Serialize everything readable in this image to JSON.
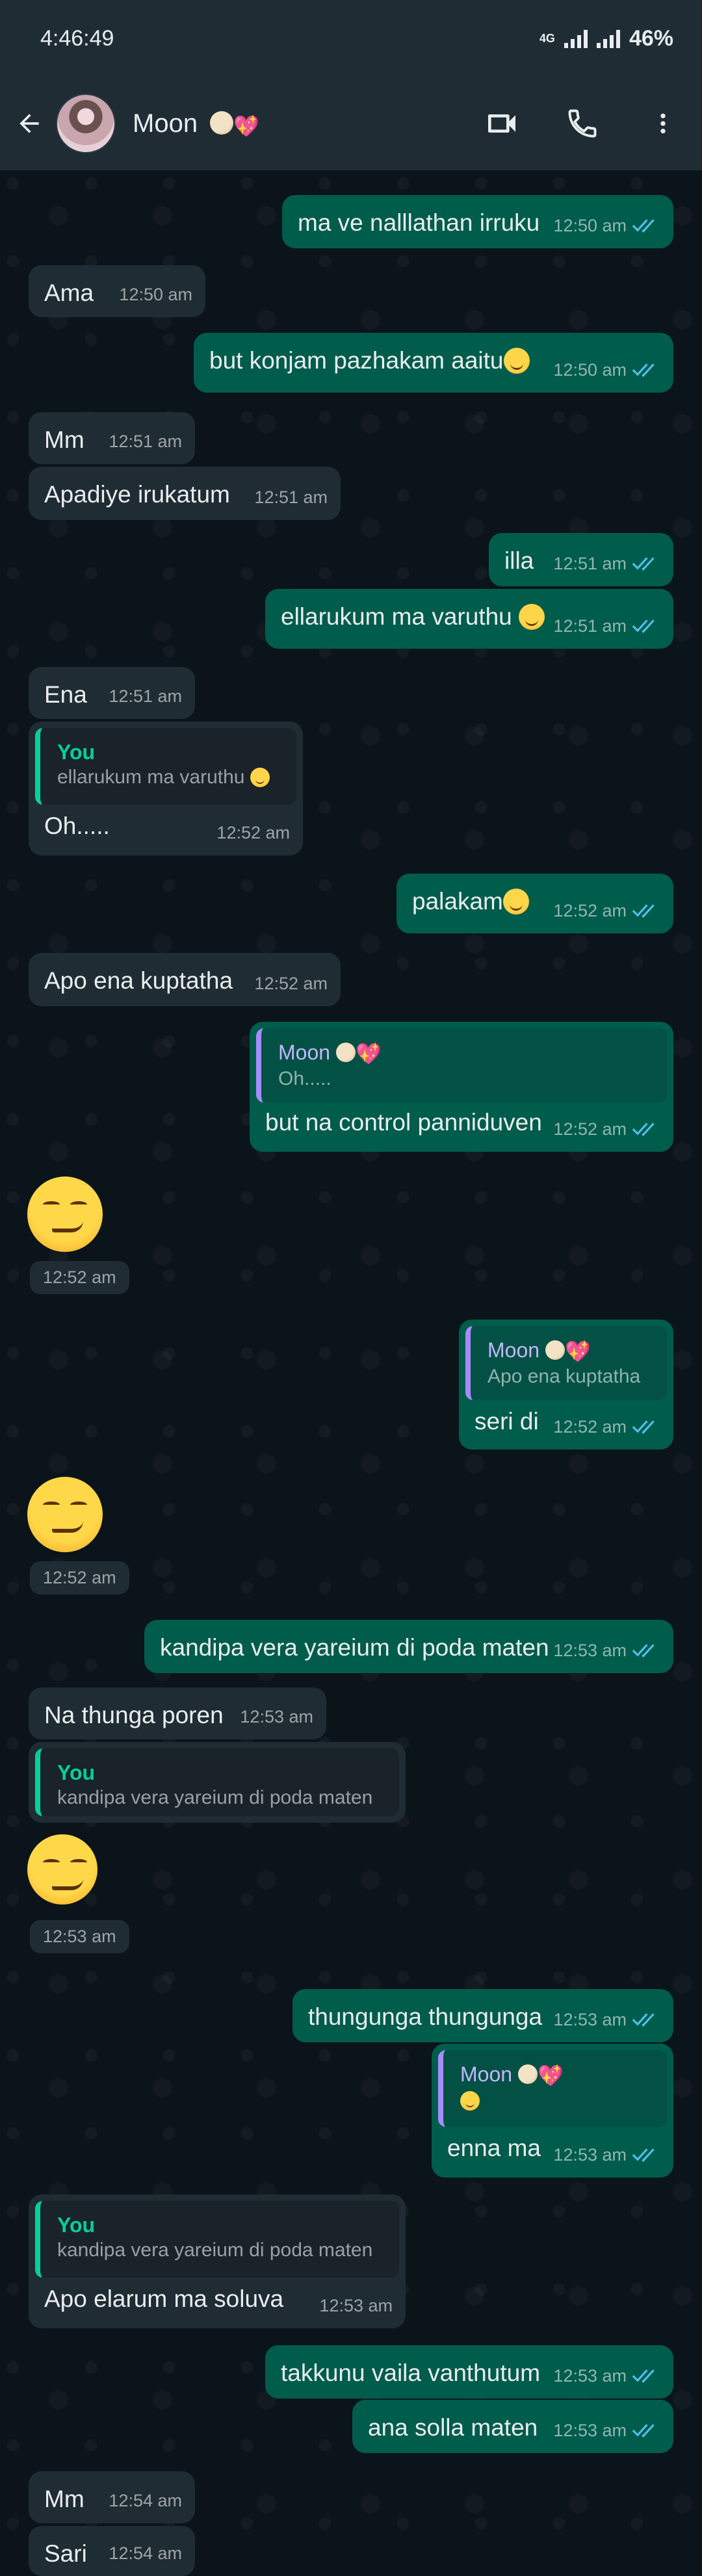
{
  "status_bar": {
    "time": "4:46:49",
    "network": "4G",
    "battery": "46%"
  },
  "header": {
    "contact_name": "Moon",
    "icons": [
      "back-arrow-icon",
      "video-call-icon",
      "voice-call-icon",
      "more-options-icon"
    ]
  },
  "colors": {
    "incoming": "#202c33",
    "outgoing": "#005c4b",
    "background": "#0b141a",
    "accent": "#06cf9c",
    "ticks": "#53bdeb"
  },
  "messages": [
    {
      "dir": "out",
      "text": "ma ve nalllathan irruku",
      "time": "12:50 am"
    },
    {
      "dir": "in",
      "text": "Ama",
      "time": "12:50 am"
    },
    {
      "dir": "out",
      "text": "but konjam pazhakam aaitu",
      "emoji": "grinning-sweat",
      "time": "12:50 am"
    },
    {
      "dir": "in",
      "text": "Mm",
      "time": "12:51 am"
    },
    {
      "dir": "in",
      "text": "Apadiye irukatum",
      "time": "12:51 am"
    },
    {
      "dir": "out",
      "text": "illa",
      "time": "12:51 am"
    },
    {
      "dir": "out",
      "text": "ellarukum ma varuthu",
      "emoji": "grinning-sweat",
      "time": "12:51 am"
    },
    {
      "dir": "in",
      "text": "Ena",
      "time": "12:51 am"
    },
    {
      "dir": "in",
      "quote_name": "You",
      "quote_text": "ellarukum ma varuthu",
      "text": "Oh.....",
      "time": "12:52 am"
    },
    {
      "dir": "out",
      "text": "palakam",
      "emoji": "grinning-sweat",
      "time": "12:52 am"
    },
    {
      "dir": "in",
      "text": "Apo ena kuptatha",
      "time": "12:52 am"
    },
    {
      "dir": "out",
      "quote_name": "Moon",
      "quote_text": "Oh.....",
      "text": "but na control panniduven",
      "time": "12:52 am"
    },
    {
      "dir": "in",
      "emoji_only": "smirking-face",
      "time": "12:52 am"
    },
    {
      "dir": "out",
      "quote_name": "Moon",
      "quote_text": "Apo ena kuptatha",
      "text": "seri di",
      "time": "12:52 am"
    },
    {
      "dir": "in",
      "emoji_only": "smirking-face",
      "time": "12:52 am"
    },
    {
      "dir": "out",
      "text": "kandipa vera yareium di poda maten",
      "time": "12:53 am"
    },
    {
      "dir": "in",
      "text": "Na thunga poren",
      "time": "12:53 am"
    },
    {
      "dir": "in",
      "quote_name": "You",
      "quote_text": "kandipa vera yareium di poda maten",
      "emoji_only": "smirking-face",
      "time": "12:53 am"
    },
    {
      "dir": "out",
      "text": "thungunga thungunga",
      "time": "12:53 am"
    },
    {
      "dir": "out",
      "quote_name": "Moon",
      "quote_emoji": "smirking-face",
      "text": "enna ma",
      "time": "12:53 am"
    },
    {
      "dir": "in",
      "quote_name": "You",
      "quote_text": "kandipa vera yareium di poda maten",
      "text": "Apo elarum ma soluva",
      "time": "12:53 am"
    },
    {
      "dir": "out",
      "text": "takkunu vaila vanthutum",
      "time": "12:53 am"
    },
    {
      "dir": "out",
      "text": "ana solla maten",
      "time": "12:53 am"
    },
    {
      "dir": "in",
      "text": "Mm",
      "time": "12:54 am"
    },
    {
      "dir": "in",
      "text": "Sari",
      "time": "12:54 am"
    }
  ]
}
